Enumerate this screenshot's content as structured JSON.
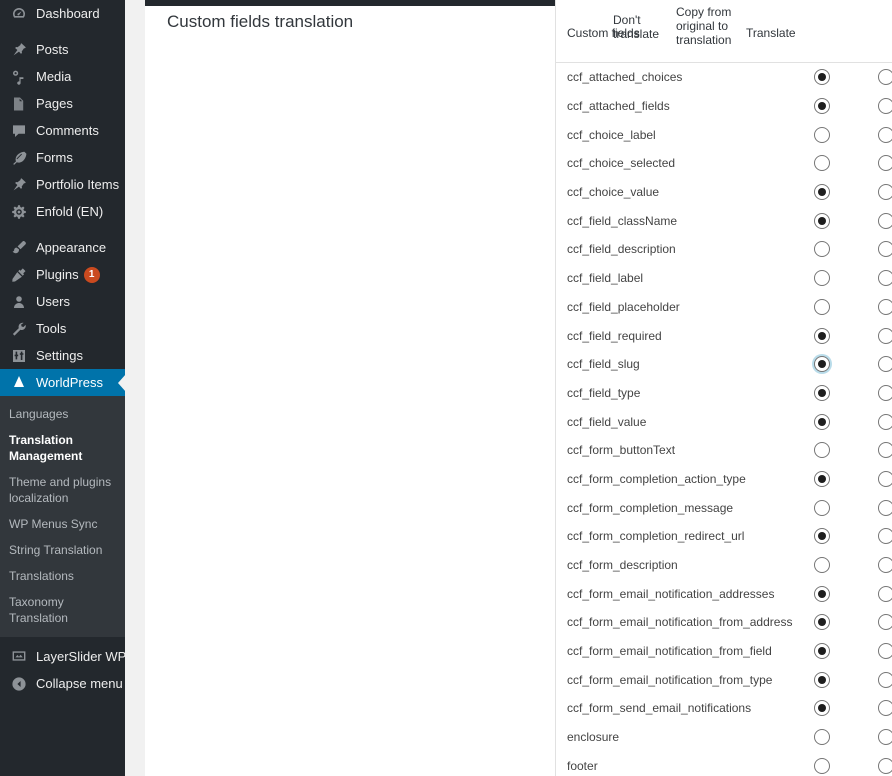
{
  "sidebar": {
    "menu": [
      {
        "label": "Dashboard",
        "icon": "dashboard-icon",
        "name": "sidebar-item-dashboard",
        "gap_after": true
      },
      {
        "label": "Posts",
        "icon": "pin-icon",
        "name": "sidebar-item-posts"
      },
      {
        "label": "Media",
        "icon": "media-icon",
        "name": "sidebar-item-media"
      },
      {
        "label": "Pages",
        "icon": "page-icon",
        "name": "sidebar-item-pages"
      },
      {
        "label": "Comments",
        "icon": "comment-icon",
        "name": "sidebar-item-comments"
      },
      {
        "label": "Forms",
        "icon": "feather-icon",
        "name": "sidebar-item-forms"
      },
      {
        "label": "Portfolio Items",
        "icon": "pin-icon",
        "name": "sidebar-item-portfolio-items"
      },
      {
        "label": "Enfold (EN)",
        "icon": "gear-icon",
        "name": "sidebar-item-enfold",
        "gap_after": true
      },
      {
        "label": "Appearance",
        "icon": "brush-icon",
        "name": "sidebar-item-appearance"
      },
      {
        "label": "Plugins",
        "icon": "plug-icon",
        "name": "sidebar-item-plugins",
        "badge": "1"
      },
      {
        "label": "Users",
        "icon": "user-icon",
        "name": "sidebar-item-users"
      },
      {
        "label": "Tools",
        "icon": "wrench-icon",
        "name": "sidebar-item-tools"
      },
      {
        "label": "Settings",
        "icon": "sliders-icon",
        "name": "sidebar-item-settings"
      }
    ],
    "active": {
      "label": "WorldPress",
      "icon": "worldpress-icon",
      "name": "sidebar-item-worldpress"
    },
    "submenu": [
      {
        "label": "Languages",
        "name": "submenu-item-languages",
        "current": false
      },
      {
        "label": "Translation Management",
        "name": "submenu-item-translation-management",
        "current": true
      },
      {
        "label": "Theme and plugins localization",
        "name": "submenu-item-theme-plugins-localization",
        "current": false
      },
      {
        "label": "WP Menus Sync",
        "name": "submenu-item-wp-menus-sync",
        "current": false
      },
      {
        "label": "String Translation",
        "name": "submenu-item-string-translation",
        "current": false
      },
      {
        "label": "Translations",
        "name": "submenu-item-translations",
        "current": false
      },
      {
        "label": "Taxonomy Translation",
        "name": "submenu-item-taxonomy-translation",
        "current": false
      }
    ],
    "footer": [
      {
        "label": "LayerSlider WP",
        "icon": "layerslider-icon",
        "name": "sidebar-item-layerslider-wp"
      },
      {
        "label": "Collapse menu",
        "icon": "collapse-icon",
        "name": "collapse-menu-button"
      }
    ],
    "accent_color": "#0073aa",
    "badge_color": "#ca4a1f"
  },
  "page": {
    "title": "Custom fields translation"
  },
  "table": {
    "headers": {
      "name": "Custom fields",
      "dont_translate": "Don't translate",
      "copy_from_original": "Copy from original to translation",
      "translate": "Translate"
    },
    "rows": [
      {
        "field": "ccf_attached_choices",
        "selected": "dont"
      },
      {
        "field": "ccf_attached_fields",
        "selected": "dont"
      },
      {
        "field": "ccf_choice_label",
        "selected": "translate"
      },
      {
        "field": "ccf_choice_selected",
        "selected": "translate"
      },
      {
        "field": "ccf_choice_value",
        "selected": "dont"
      },
      {
        "field": "ccf_field_className",
        "selected": "dont"
      },
      {
        "field": "ccf_field_description",
        "selected": "translate"
      },
      {
        "field": "ccf_field_label",
        "selected": "translate"
      },
      {
        "field": "ccf_field_placeholder",
        "selected": "translate"
      },
      {
        "field": "ccf_field_required",
        "selected": "dont"
      },
      {
        "field": "ccf_field_slug",
        "selected": "dont",
        "focused": "dont"
      },
      {
        "field": "ccf_field_type",
        "selected": "dont"
      },
      {
        "field": "ccf_field_value",
        "selected": "dont"
      },
      {
        "field": "ccf_form_buttonText",
        "selected": "translate"
      },
      {
        "field": "ccf_form_completion_action_type",
        "selected": "dont"
      },
      {
        "field": "ccf_form_completion_message",
        "selected": "translate"
      },
      {
        "field": "ccf_form_completion_redirect_url",
        "selected": "dont"
      },
      {
        "field": "ccf_form_description",
        "selected": "translate"
      },
      {
        "field": "ccf_form_email_notification_addresses",
        "selected": "dont"
      },
      {
        "field": "ccf_form_email_notification_from_address",
        "selected": "dont"
      },
      {
        "field": "ccf_form_email_notification_from_field",
        "selected": "dont"
      },
      {
        "field": "ccf_form_email_notification_from_type",
        "selected": "dont"
      },
      {
        "field": "ccf_form_send_email_notifications",
        "selected": "dont"
      },
      {
        "field": "enclosure",
        "selected": "none"
      },
      {
        "field": "footer",
        "selected": "none"
      }
    ]
  }
}
